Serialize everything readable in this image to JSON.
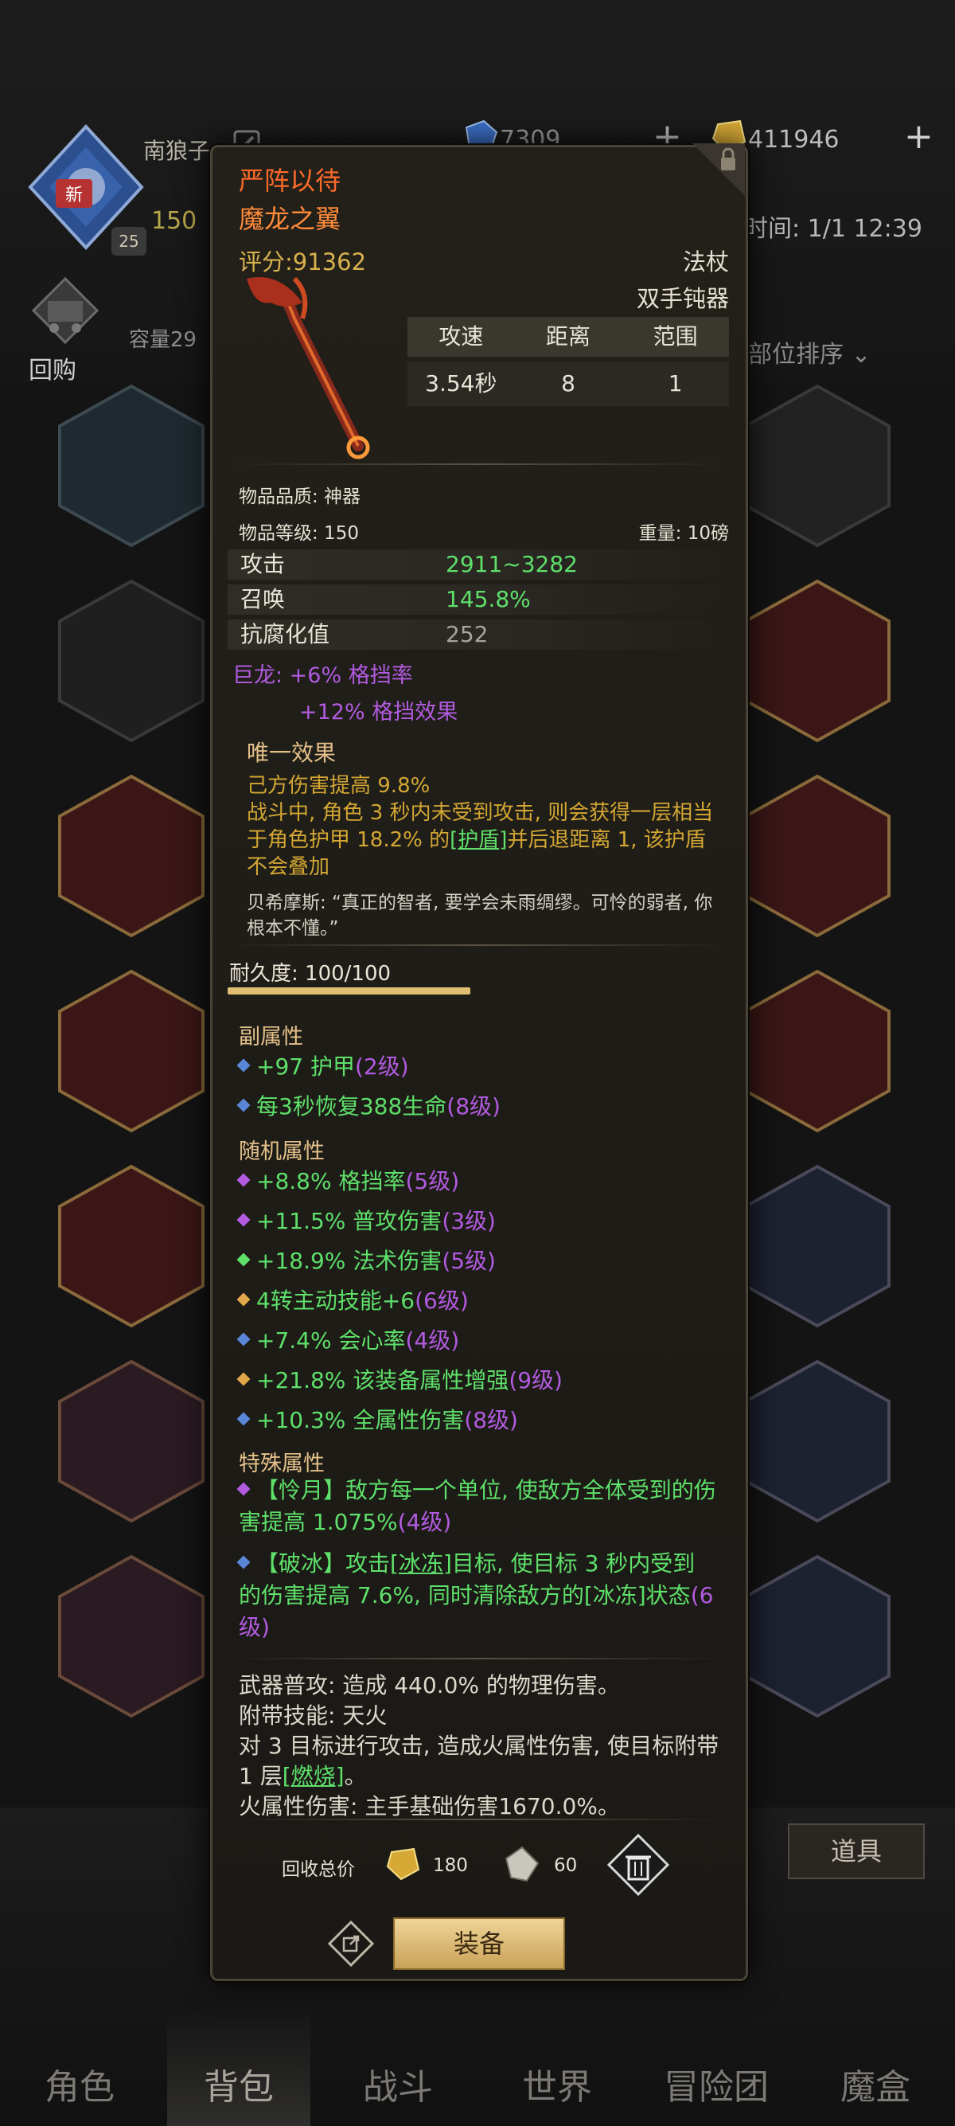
{
  "hud": {
    "player_name": "南狼子",
    "level_text": "150",
    "level_badge": "25",
    "new_tag": "新",
    "gems": "7309",
    "gold": "411946",
    "time": "时间: 1/1 12:39",
    "buyback": "回购",
    "capacity": "容量29",
    "sort_label": "部位排序",
    "tool_button": "道具"
  },
  "nav": [
    "角色",
    "背包",
    "战斗",
    "世界",
    "冒险团",
    "魔盒"
  ],
  "item": {
    "name": "严阵以待",
    "subtitle": "魔龙之翼",
    "score": "评分:91362",
    "class": "法杖",
    "subclass": "双手钝器",
    "stats_headers": [
      "攻速",
      "距离",
      "范围"
    ],
    "stats_values": [
      "3.54秒",
      "8",
      "1"
    ],
    "quality": "物品品质: 神器",
    "item_level": "物品等级: 150",
    "weight": "重量: 10磅",
    "main_stats": [
      {
        "label": "攻击",
        "value": "2911~3282"
      },
      {
        "label": "召唤",
        "value": "145.8%"
      },
      {
        "label": "抗腐化值",
        "value": "252"
      }
    ],
    "dragon_line1": "巨龙: +6% 格挡率",
    "dragon_line2": "+12% 格挡效果",
    "unique_title": "唯一效果",
    "unique_line1": "己方伤害提高 9.8%",
    "unique_line2a": "战斗中, 角色 3 秒内未受到攻击, 则会获得一层相当于角色护甲 18.2% 的",
    "unique_link": "[护盾]",
    "unique_line2b": "并后退距离 1, 该护盾不会叠加",
    "quote": "贝希摩斯: “真正的智者, 要学会未雨绸缪。可怜的弱者, 你根本不懂。”",
    "durability": "耐久度: 100/100",
    "durability_ratio": 1.0,
    "secondary_title": "副属性",
    "secondary": [
      {
        "text": "+97 护甲",
        "level": "(2级)",
        "color": "blue"
      },
      {
        "text": "每3秒恢复388生命",
        "level": "(8级)",
        "color": "blue"
      }
    ],
    "random_title": "随机属性",
    "random": [
      {
        "text": "+8.8% 格挡率",
        "level": "(5级)",
        "color": "purple"
      },
      {
        "text": "+11.5% 普攻伤害",
        "level": "(3级)",
        "color": "purple"
      },
      {
        "text": "+18.9% 法术伤害",
        "level": "(5级)",
        "color": "green"
      },
      {
        "text": "4转主动技能+6",
        "level": "(6级)",
        "color": "gold"
      },
      {
        "text": "+7.4% 会心率",
        "level": "(4级)",
        "color": "blue"
      },
      {
        "text": "+21.8% 该装备属性增强",
        "level": "(9级)",
        "color": "gold"
      },
      {
        "text": "+10.3% 全属性伤害",
        "level": "(8级)",
        "color": "blue"
      }
    ],
    "special_title": "特殊属性",
    "special1_text": "【怜月】敌方每一个单位, 使敌方全体受到的伤害提高 1.075%",
    "special1_level": "(4级)",
    "special2_a": "【破冰】攻击",
    "special2_link": "[冰冻]",
    "special2_b": "目标, 使目标 3 秒内受到的伤害提高 7.6%, 同时清除敌方的[冰冻]状态",
    "special2_level": "(6级)",
    "basic_line1": "武器普攻: 造成 440.0% 的物理伤害。",
    "basic_line2": "附带技能: 天火",
    "basic_line3": "对 3 目标进行攻击, 造成火属性伤害, 使目标附带 1 层",
    "basic_link": "[燃烧]",
    "basic_line3_end": "。",
    "basic_line4": "火属性伤害: 主手基础伤害1670.0%。",
    "recycle_label": "回收总价",
    "recycle_gold": "180",
    "recycle_gem": "60",
    "equip_button": "装备"
  },
  "colors": {
    "name": "#ff6a2a",
    "green_attr": "#5ee06a",
    "purple_attr": "#b25be0",
    "gold_text": "#d4a734",
    "panel_bg": "#1e1c17"
  },
  "icons": [
    "lock-icon",
    "edit-icon",
    "gem-icon",
    "gold-icon",
    "cart-icon",
    "trash-icon",
    "share-icon",
    "chevron-down-icon"
  ]
}
